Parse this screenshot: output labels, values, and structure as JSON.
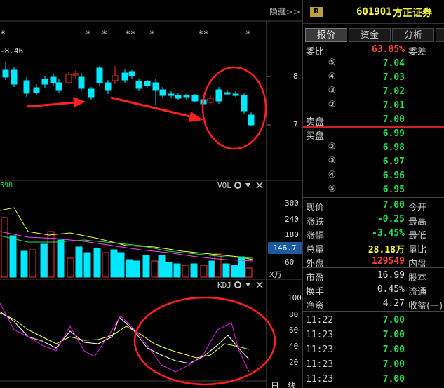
{
  "left": {
    "hide_label": "隐藏",
    "hide_arrows": ">>",
    "ma_label": "-8.46",
    "ma_label2": "598",
    "price_axis": [
      "8",
      "7"
    ],
    "vol_title": "VOL",
    "vol_axis": [
      "300",
      "240",
      "180",
      "120",
      "60"
    ],
    "vol_current": "146.7",
    "vol_unit": "X万",
    "kdj_title": "KDJ",
    "kdj_axis": [
      "100",
      "80",
      "60",
      "40",
      "20"
    ],
    "bottom_tabs": [
      "日",
      "线"
    ],
    "star_marks": [
      "*",
      "*",
      "*",
      "**",
      "*",
      "**",
      "*"
    ]
  },
  "stock": {
    "badge": "R",
    "code": "601901",
    "name": "方正证券"
  },
  "tabs": [
    "报价",
    "资金",
    "分析"
  ],
  "order_ratio": {
    "label": "委比",
    "value": "63.85%",
    "label2": "委差"
  },
  "sell": [
    {
      "num": "⑤",
      "price": "7.04"
    },
    {
      "num": "④",
      "price": "7.03"
    },
    {
      "num": "③",
      "price": "7.02"
    },
    {
      "num": "②",
      "price": "7.01"
    },
    {
      "num": "①",
      "price": "7.00",
      "label": "卖盘"
    }
  ],
  "buy": [
    {
      "num": "①",
      "price": "6.99",
      "label": "买盘"
    },
    {
      "num": "②",
      "price": "6.98"
    },
    {
      "num": "③",
      "price": "6.97"
    },
    {
      "num": "④",
      "price": "6.96"
    },
    {
      "num": "⑤",
      "price": "6.95"
    }
  ],
  "quote": [
    {
      "label": "现价",
      "value": "7.00",
      "label2": "今开",
      "color": "green"
    },
    {
      "label": "涨跌",
      "value": "-0.25",
      "label2": "最高",
      "color": "green"
    },
    {
      "label": "涨幅",
      "value": "-3.45%",
      "label2": "最低",
      "color": "green"
    },
    {
      "label": "总量",
      "value": "28.18万",
      "label2": "量比",
      "color": "yellow"
    },
    {
      "label": "外盘",
      "value": "129549",
      "label2": "内盘",
      "color": "red"
    }
  ],
  "fund": [
    {
      "label": "市盈",
      "value": "16.99",
      "label2": "股本",
      "color": "gray"
    },
    {
      "label": "换手",
      "value": "0.45%",
      "label2": "流通",
      "color": "gray"
    },
    {
      "label": "净资",
      "value": "4.27",
      "label2": "收益(一)",
      "color": "gray"
    }
  ],
  "ticks": [
    {
      "time": "11:22",
      "price": "7.00"
    },
    {
      "time": "11:23",
      "price": "7.00"
    },
    {
      "time": "11:23",
      "price": "7.00"
    },
    {
      "time": "11:23",
      "price": "7.00"
    },
    {
      "time": "11:23",
      "price": "7.00"
    }
  ],
  "colors": {
    "up": "#ff3030",
    "down": "#00e8ff",
    "annot": "#ff2020"
  }
}
